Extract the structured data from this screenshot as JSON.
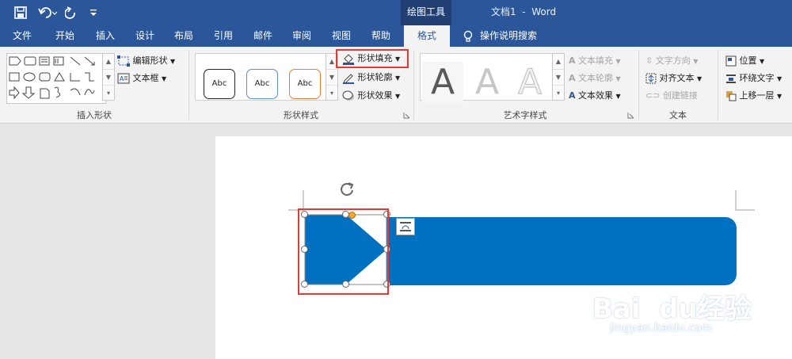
{
  "titlebar": {
    "contextual_tab_group": "绘图工具",
    "doc_title": "文档1  -  Word"
  },
  "tabs": [
    {
      "label": "文件"
    },
    {
      "label": "开始"
    },
    {
      "label": "插入"
    },
    {
      "label": "设计"
    },
    {
      "label": "布局"
    },
    {
      "label": "引用"
    },
    {
      "label": "邮件"
    },
    {
      "label": "审阅"
    },
    {
      "label": "视图"
    },
    {
      "label": "帮助"
    },
    {
      "label": "格式"
    }
  ],
  "tell_me": "操作说明搜索",
  "ribbon": {
    "insert_shapes": {
      "label": "插入形状",
      "edit_shape": "编辑形状",
      "text_box": "文本框"
    },
    "shape_styles": {
      "label": "形状样式",
      "preset_text": [
        "Abc",
        "Abc",
        "Abc"
      ],
      "fill": "形状填充",
      "outline": "形状轮廓",
      "effects": "形状效果"
    },
    "wordart_styles": {
      "label": "艺术字样式",
      "letter": "A",
      "text_fill": "文本填充",
      "text_outline": "文本轮廓",
      "text_effects": "文本效果"
    },
    "text": {
      "label": "文本",
      "direction": "文字方向",
      "align": "对齐文本",
      "link": "创建链接"
    },
    "arrange": {
      "position": "位置",
      "wrap": "环绕文字",
      "bring_forward": "上移一层"
    }
  },
  "colors": {
    "accent": "#2b579a",
    "shape_blue": "#0070c0",
    "highlight_red": "#e53935"
  },
  "watermark": {
    "brand": "Bai  du经验",
    "url": "jingyan.baidu.com"
  }
}
